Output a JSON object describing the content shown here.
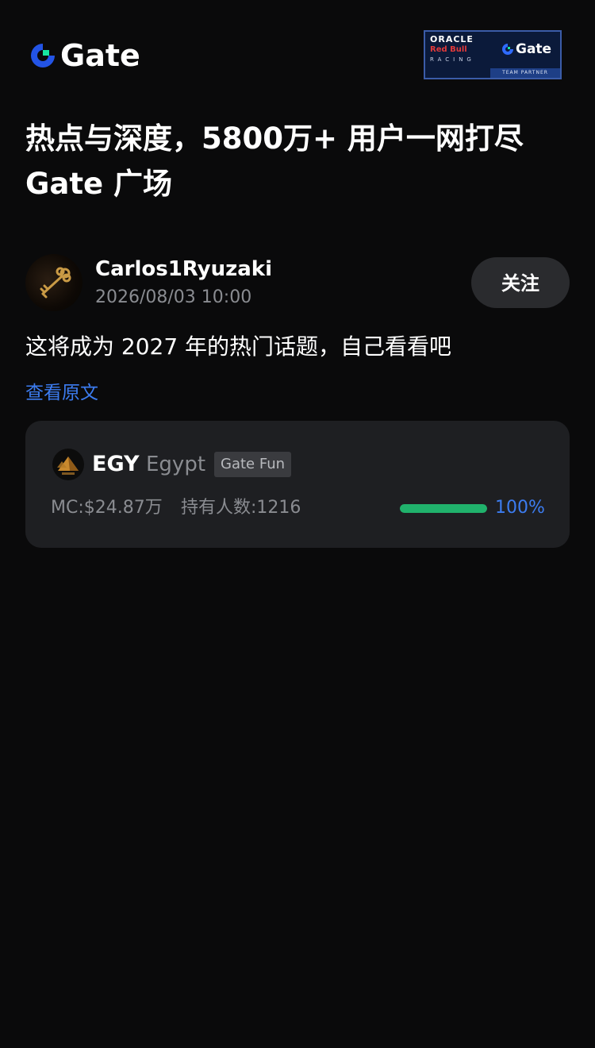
{
  "header": {
    "logo_text": "Gate",
    "partner_badge": {
      "line1": "ORACLE",
      "line2": "Red Bull",
      "line3": "RACING",
      "brand": "Gate",
      "strip": "TEAM PARTNER"
    }
  },
  "headline": {
    "line1": "热点与深度，5800万+ 用户一网打尽",
    "line2": "Gate 广场"
  },
  "post": {
    "author": "Carlos1Ryuzaki",
    "time": "2026/08/03 10:00",
    "follow_label": "关注",
    "text": "这将成为 2027 年的热门话题，自己看看吧",
    "view_original": "查看原文"
  },
  "token": {
    "symbol": "EGY",
    "name": "Egypt",
    "tag": "Gate Fun",
    "market_cap": "MC:$24.87万",
    "holders": "持有人数:1216",
    "progress_fraction": 1.0,
    "progress_label": "100%"
  },
  "colors": {
    "background": "#0a0a0b",
    "accent_blue": "#3c7cf0",
    "progress_green": "#20b26c",
    "card_bg": "#1e1f22"
  },
  "icons": {
    "logo": "gate-logo-icon",
    "avatar": "golden-key-avatar",
    "token": "pyramid-token-icon"
  }
}
